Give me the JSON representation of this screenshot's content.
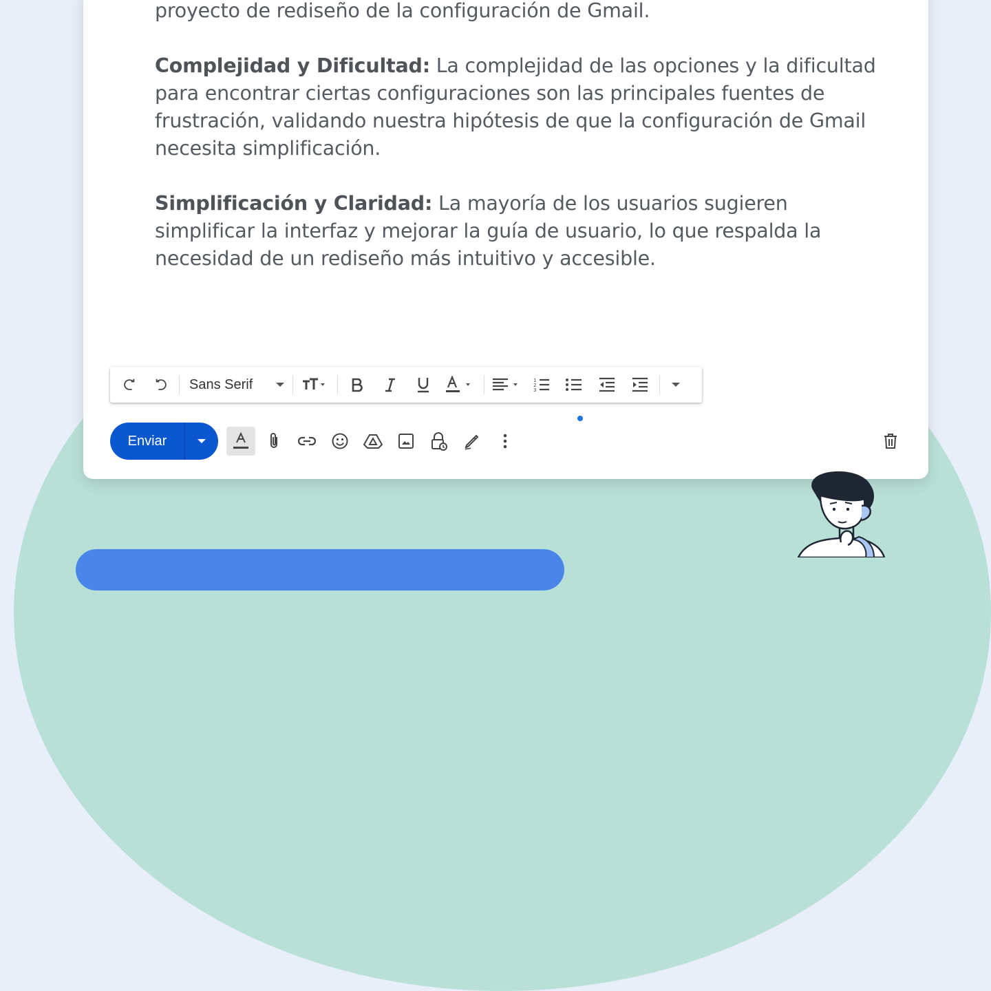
{
  "email": {
    "paragraphs": [
      {
        "bold": "",
        "text": "proyecto de rediseño de la configuración de Gmail."
      },
      {
        "bold": "Complejidad y Dificultad:",
        "text": " La complejidad de las opciones y la dificultad para encontrar ciertas configuraciones son las principales fuentes de frustración, validando nuestra hipótesis de que la configuración de Gmail necesita simplificación."
      },
      {
        "bold": "Simplificación y Claridad:",
        "text": " La mayoría de los usuarios sugieren simplificar la interfaz y mejorar la guía de usuario, lo que respalda la necesidad de un rediseño más intuitivo y accesible."
      }
    ]
  },
  "format_toolbar": {
    "font": "Sans Serif",
    "icons": [
      "undo-icon",
      "redo-icon",
      "font-size-icon",
      "bold-icon",
      "italic-icon",
      "underline-icon",
      "text-color-icon",
      "align-icon",
      "numbered-list-icon",
      "bulleted-list-icon",
      "indent-less-icon",
      "indent-more-icon",
      "more-formatting-icon"
    ]
  },
  "compose_actions": {
    "send_label": "Enviar",
    "icons": [
      "formatting-options-icon",
      "attach-icon",
      "link-icon",
      "emoji-icon",
      "drive-icon",
      "photo-icon",
      "confidential-mode-icon",
      "signature-icon",
      "more-options-icon",
      "discard-icon"
    ],
    "accent_color": "#0b57d0"
  }
}
